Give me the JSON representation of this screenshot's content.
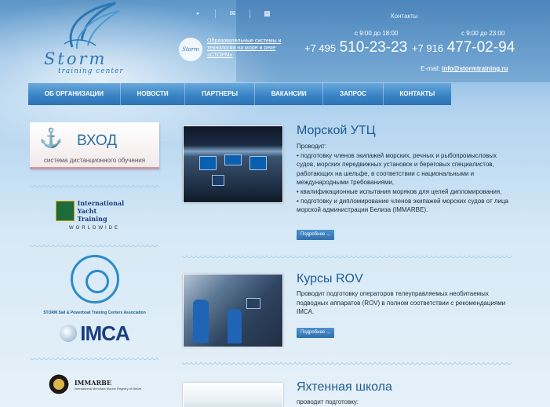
{
  "header": {
    "logo_word": "Storm",
    "logo_sub": "training center",
    "contacts_link": "Контакты",
    "icons": [
      "home-icon",
      "mail-icon",
      "sitemap-icon"
    ],
    "mini_logo": "Storm",
    "tagline": "Образовательные системы и технологии на море и реке «СТОРМ»",
    "phone1": {
      "hours": "с 9:00 до 18:00",
      "code": "+7 495",
      "number": "510-23-23"
    },
    "phone2": {
      "hours": "с 9:00 до 23:00",
      "code": "+7 916",
      "number": "477-02-94"
    },
    "email_label": "E-mail:",
    "email": "info@stormtraining.ru"
  },
  "nav": [
    "ОБ ОРГАНИЗАЦИИ",
    "НОВОСТИ",
    "ПАРТНЕРЫ",
    "ВАКАНСИИ",
    "ЗАПРОС",
    "КОНТАКТЫ"
  ],
  "sidebar": {
    "login_title": "ВХОД",
    "login_sub": "система дистанционного обучения",
    "partners": {
      "iyt_line1": "International",
      "iyt_line2": "Yacht",
      "iyt_line3": "Training",
      "iyt_ww": "WORLDWIDE",
      "ring_text": "STORM Sail & Powerboat Training Centers Association",
      "imca": "IMCA",
      "immarbe": "IMMARBE",
      "immarbe_small": "International Merchant Marine Registry of Belize"
    }
  },
  "articles": [
    {
      "title": "Морской УТЦ",
      "lines": [
        "Проводит:",
        "• подготовку членов экипажей морских, речных и рыбопромысловых судов, морских передвижных установок и береговых специалистов, работающих на шельфе, в соответствии с национальными и международными требованиями,",
        "• квалификационные испытания моряков для целей дипломирования,",
        "• подготовку и дипломирование членов экипажей морских судов от лица морской администрации Белиза (IMMARBE)."
      ],
      "more": "Подробнее"
    },
    {
      "title": "Курсы ROV",
      "lines": [
        "Проводит подготовку операторов телеуправляемых необитаемых подводных аппаратов (ROV) в полном соответствии с рекомендациями IMCA."
      ],
      "more": "Подробнее"
    },
    {
      "title": "Яхтенная школа",
      "lines": [
        "проводит подготовку:"
      ],
      "more": ""
    }
  ]
}
